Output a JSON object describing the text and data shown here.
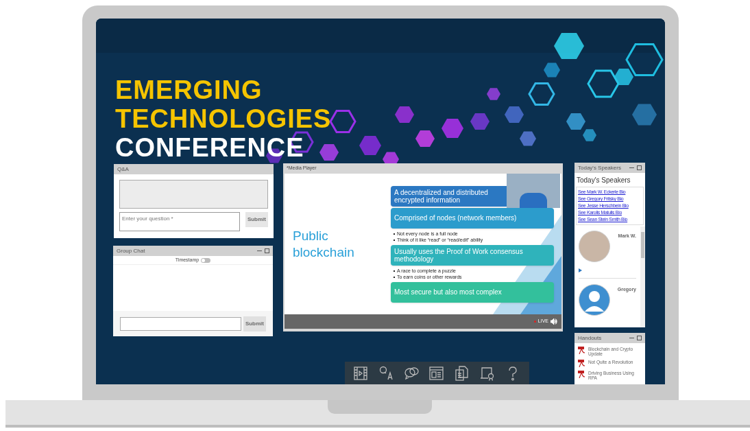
{
  "banner": {
    "lines": [
      {
        "text": "EMERGING",
        "color": "#f5c400"
      },
      {
        "text": "TECHNOLOGIES",
        "color": "#f5c400"
      },
      {
        "text": "CONFERENCE",
        "color": "#ffffff"
      }
    ]
  },
  "qa_panel": {
    "title": "Q&A",
    "question_field": {
      "placeholder": "Enter your question *"
    },
    "submit_button": "Submit"
  },
  "group_chat": {
    "title": "Group Chat",
    "timestamp_toggle": {
      "label": "Timestamp",
      "on": false
    },
    "submit_button": "Submit"
  },
  "media_player": {
    "title": "*Media Player",
    "slide": {
      "title": "Public blockchain",
      "blocks": [
        {
          "text": "A decentralized and distributed encrypted information",
          "color": "#2b78c2"
        },
        {
          "text": "Comprised of nodes (network members)",
          "color": "#2c9ccc",
          "bullets": [
            "Not every node is a full node",
            "Think of it like “read” or “read/edit” ability"
          ]
        },
        {
          "text": "Usually uses the Proof of Work consensus methodology",
          "color": "#2fb3bb",
          "bullets": [
            "A race to complete a puzzle",
            "To earn coins or other rewards"
          ]
        },
        {
          "text": "Most secure but also most complex",
          "color": "#33c09c"
        }
      ]
    },
    "live_label": "LIVE"
  },
  "speakers_panel": {
    "title": "Today's Speakers",
    "heading": "Today's Speakers",
    "bio_links": [
      "See Mark W. Eckerle Bio",
      "See Gregory Fritsky Bio",
      "See Jesse Herschbein Bio",
      "See Karolis Matulis Bio",
      "See Sean Stein Smith Bio"
    ],
    "speakers": [
      {
        "name": "Mark W.",
        "kind": "photo"
      },
      {
        "name": "Gregory",
        "kind": "silhouette"
      }
    ]
  },
  "handouts": {
    "title": "Handouts",
    "items": [
      "Blockchain and Crypto Update",
      "Not Quite a Revolution",
      "Driving Business Using RPA"
    ]
  }
}
